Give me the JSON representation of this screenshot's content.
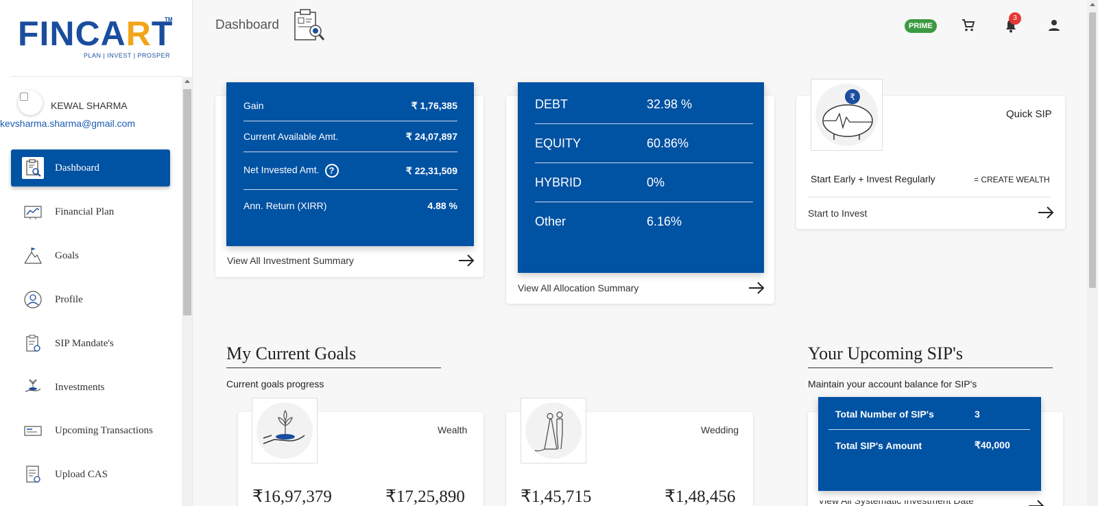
{
  "brand": {
    "logo_text_left": "FINCA",
    "logo_text_accent": "R",
    "logo_text_right": "T",
    "logo_tm": "TM",
    "tagline": "PLAN | INVEST | PROSPER"
  },
  "user": {
    "name": "KEWAL SHARMA",
    "email": "kevsharma.sharma@gmail.com"
  },
  "sidebar": {
    "items": [
      {
        "label": "Dashboard",
        "icon": "dashboard-icon",
        "active": true
      },
      {
        "label": "Financial Plan",
        "icon": "chart-icon"
      },
      {
        "label": "Goals",
        "icon": "mountain-flag-icon"
      },
      {
        "label": "Profile",
        "icon": "user-circle-icon"
      },
      {
        "label": "SIP Mandate's",
        "icon": "clipboard-icon"
      },
      {
        "label": "Investments",
        "icon": "plant-hand-icon"
      },
      {
        "label": "Upcoming Transactions",
        "icon": "card-icon"
      },
      {
        "label": "Upload CAS",
        "icon": "document-upload-icon"
      }
    ]
  },
  "header": {
    "title": "Dashboard",
    "prime_label": "PRIME",
    "notification_count": "3",
    "icons": [
      "cart-icon",
      "bell-icon",
      "account-icon"
    ]
  },
  "investment_summary": {
    "rows": [
      {
        "label": "Gain",
        "value": "₹ 1,76,385"
      },
      {
        "label": "Current Available Amt.",
        "value": "₹ 24,07,897"
      },
      {
        "label": "Net Invested Amt.",
        "value": "₹ 22,31,509",
        "help": "?"
      },
      {
        "label": "Ann. Return (XIRR)",
        "value": "4.88 %"
      }
    ],
    "link": "View All Investment Summary"
  },
  "allocation": {
    "rows": [
      {
        "category": "DEBT",
        "value": "32.98 %"
      },
      {
        "category": "EQUITY",
        "value": "60.86%"
      },
      {
        "category": "HYBRID",
        "value": "0%"
      },
      {
        "category": "Other",
        "value": "6.16%"
      }
    ],
    "link": "View All Allocation Summary"
  },
  "quick_sip": {
    "title": "Quick SIP",
    "tagline": "Start Early + Invest Regularly",
    "tagline_right": "= CREATE WEALTH",
    "link": "Start to Invest",
    "rupee_symbol": "₹"
  },
  "goals": {
    "title": "My Current Goals",
    "subtitle": "Current goals progress",
    "items": [
      {
        "name": "Wealth",
        "amount_current": "₹16,97,379",
        "amount_target": "₹17,25,890"
      },
      {
        "name": "Wedding",
        "amount_current": "₹1,45,715",
        "amount_target": "₹1,48,456"
      }
    ]
  },
  "upcoming_sips": {
    "title": "Your Upcoming SIP's",
    "subtitle": "Maintain your account balance for SIP's",
    "rows": [
      {
        "label": "Total Number of SIP's",
        "value": "3"
      },
      {
        "label": "Total SIP's Amount",
        "value": "₹40,000"
      }
    ],
    "link": "View All Systematic Investment Date"
  },
  "colors": {
    "primary": "#0052a3",
    "brand_blue": "#1a4d9e",
    "brand_orange": "#f2a51a",
    "prime_green": "#3c9a40",
    "notification_red": "#e53935"
  }
}
